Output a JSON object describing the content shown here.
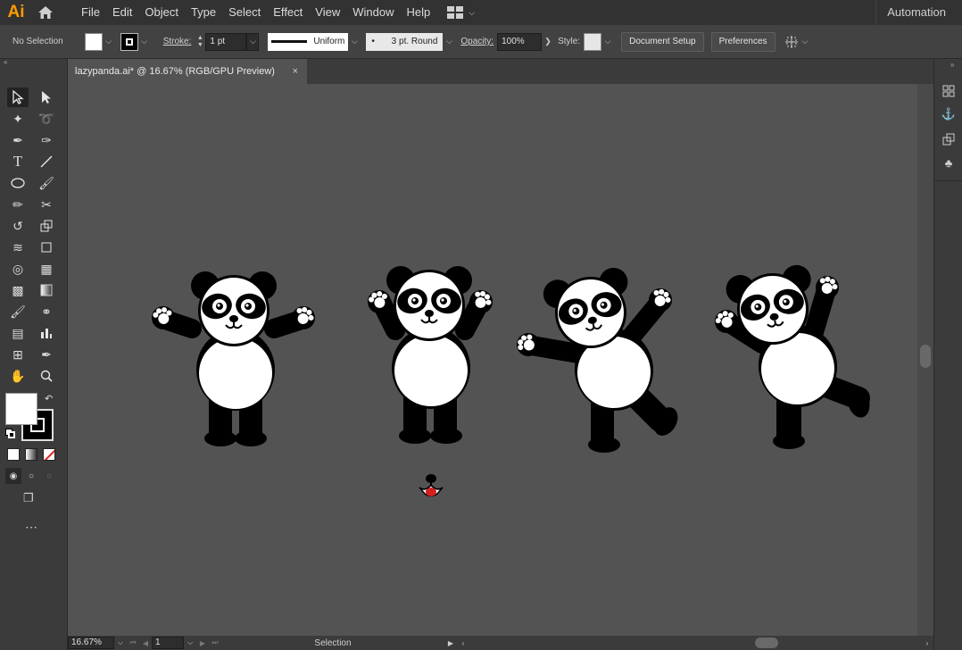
{
  "app": {
    "logo": "Ai",
    "home_icon": "home-icon"
  },
  "menu": [
    "File",
    "Edit",
    "Object",
    "Type",
    "Select",
    "Effect",
    "View",
    "Window",
    "Help"
  ],
  "workspace": {
    "label": "Automation"
  },
  "control_bar": {
    "selection_status": "No Selection",
    "stroke_label": "Stroke:",
    "stroke_weight": "1 pt",
    "stroke_profile": "Uniform",
    "brush": "3 pt. Round",
    "opacity_label": "Opacity:",
    "opacity_value": "100%",
    "style_label": "Style:",
    "document_setup": "Document Setup",
    "preferences": "Preferences"
  },
  "document_tab": {
    "title": "lazypanda.ai* @ 16.67% (RGB/GPU Preview)",
    "close": "×"
  },
  "status_bar": {
    "zoom": "16.67%",
    "page": "1",
    "tool": "Selection"
  },
  "colors": {
    "fill": "#ffffff",
    "stroke": "#000000",
    "accent": "#ff9a00",
    "canvas": "#535353"
  },
  "artboard_content": [
    "panda-standing",
    "panda-arms-up",
    "panda-waving",
    "panda-dancing",
    "panda-mouth-fragment"
  ]
}
